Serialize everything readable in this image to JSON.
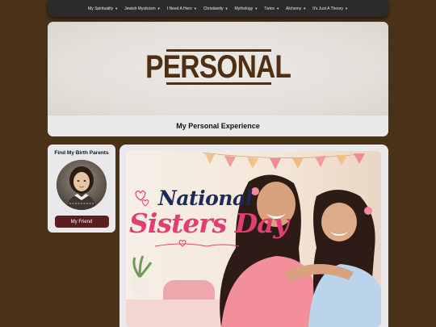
{
  "nav": {
    "items": [
      {
        "label": "My Spirituality"
      },
      {
        "label": "Jewish Mysticism"
      },
      {
        "label": "I Need A Hero"
      },
      {
        "label": "Christianity"
      },
      {
        "label": "Mythology"
      },
      {
        "label": "Twins"
      },
      {
        "label": "Alchemy"
      },
      {
        "label": "It's Just A Theory"
      }
    ],
    "caret_icon": "chevron-down-icon"
  },
  "header": {
    "logo_text": "PERSONAL",
    "title": "My Personal Experience"
  },
  "sidebar": {
    "heading": "Find My Birth Parents",
    "button_label": "My Friend"
  },
  "main": {
    "image": {
      "line1": "National",
      "line2": "Sisters Day"
    }
  },
  "colors": {
    "page_bg": "#4a3219",
    "nav_bg": "#2b2b2b",
    "card_bg": "#e9e9ec",
    "logo": "#4f2f14",
    "button": "#5a1e1e",
    "title_navy": "#1d2a57",
    "title_pink": "#e03f72"
  }
}
